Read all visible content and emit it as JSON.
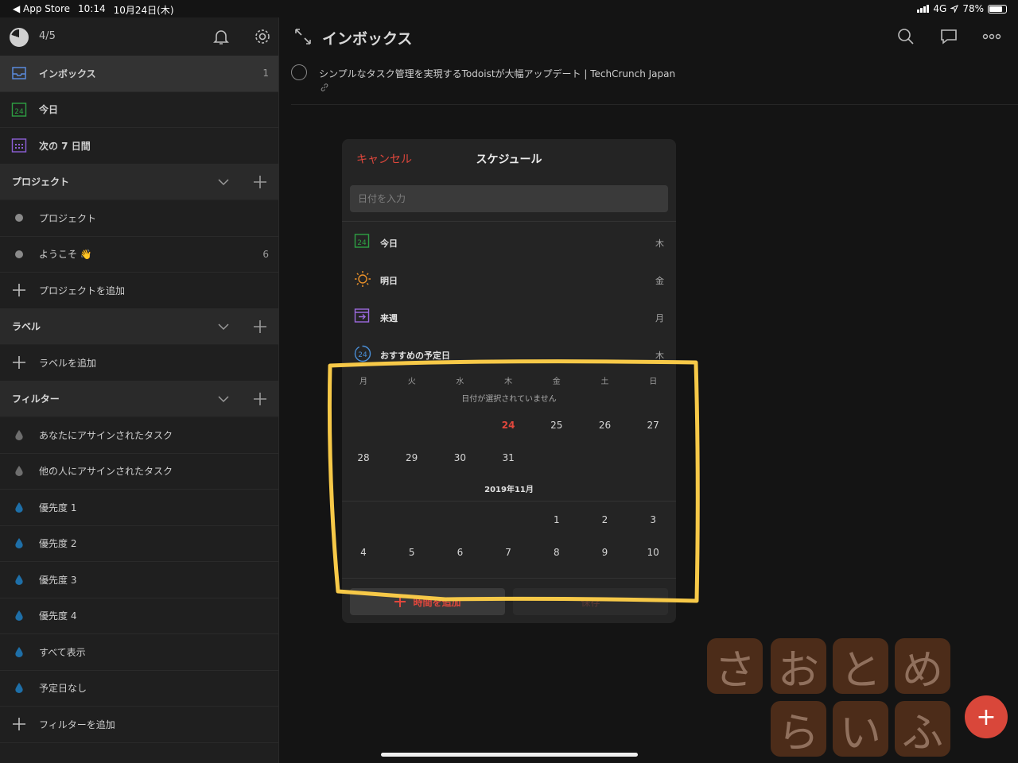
{
  "status_bar": {
    "back_app": "◀ App Store",
    "time": "10:14",
    "date": "10月24日(木)",
    "network": "4G",
    "battery": "78%",
    "battery_level": 0.78
  },
  "sidebar": {
    "karma_count": "4/5",
    "nav": [
      {
        "label": "インボックス",
        "count": "1",
        "icon": "inbox-icon",
        "color": "#5b8bdc"
      },
      {
        "label": "今日",
        "count": "",
        "icon": "calendar-today-icon",
        "color": "#2ea043"
      },
      {
        "label": "次の 7 日間",
        "count": "",
        "icon": "calendar-week-icon",
        "color": "#8d5fd6"
      }
    ],
    "projects_header": "プロジェクト",
    "projects": [
      {
        "label": "プロジェクト",
        "count": ""
      },
      {
        "label": "ようこそ 👋",
        "count": "6"
      }
    ],
    "add_project": "プロジェクトを追加",
    "labels_header": "ラベル",
    "add_label": "ラベルを追加",
    "filters_header": "フィルター",
    "filters": [
      {
        "label": "あなたにアサインされたタスク",
        "color": "#6e6e6e"
      },
      {
        "label": "他の人にアサインされたタスク",
        "color": "#6e6e6e"
      },
      {
        "label": "優先度 1",
        "color": "#1e6fa8"
      },
      {
        "label": "優先度 2",
        "color": "#1e6fa8"
      },
      {
        "label": "優先度 3",
        "color": "#1e6fa8"
      },
      {
        "label": "優先度 4",
        "color": "#1e6fa8"
      },
      {
        "label": "すべて表示",
        "color": "#1e6fa8"
      },
      {
        "label": "予定日なし",
        "color": "#1e6fa8"
      }
    ],
    "add_filter": "フィルターを追加"
  },
  "main": {
    "title": "インボックス",
    "task_text": "シンプルなタスク管理を実現するTodoistが大幅アップデート | TechCrunch Japan"
  },
  "schedule": {
    "cancel": "キャンセル",
    "title": "スケジュール",
    "input_placeholder": "日付を入力",
    "options": [
      {
        "label": "今日",
        "day": "木",
        "icon": "calendar-today-icon"
      },
      {
        "label": "明日",
        "day": "金",
        "icon": "sun-icon"
      },
      {
        "label": "来週",
        "day": "月",
        "icon": "next-week-icon"
      },
      {
        "label": "おすすめの予定日",
        "day": "木",
        "icon": "suggested-date-icon"
      }
    ],
    "weekdays": [
      "月",
      "火",
      "水",
      "木",
      "金",
      "土",
      "日"
    ],
    "no_date": "日付が選択されていません",
    "oct_weeks": [
      [
        "",
        "",
        "",
        "24",
        "25",
        "26",
        "27"
      ],
      [
        "28",
        "29",
        "30",
        "31",
        "",
        "",
        ""
      ]
    ],
    "today": "24",
    "next_month": "2019年11月",
    "nov_weeks": [
      [
        "",
        "",
        "",
        "",
        "1",
        "2",
        "3"
      ],
      [
        "4",
        "5",
        "6",
        "7",
        "8",
        "9",
        "10"
      ]
    ],
    "add_time": "時間を追加",
    "save": "保存"
  },
  "watermark": {
    "row1": [
      "さ",
      "お",
      "と",
      "め"
    ],
    "row2": [
      "ら",
      "い",
      "ふ"
    ]
  },
  "colors": {
    "accent_red": "#e0473c",
    "highlight_yellow": "#f7c948"
  }
}
